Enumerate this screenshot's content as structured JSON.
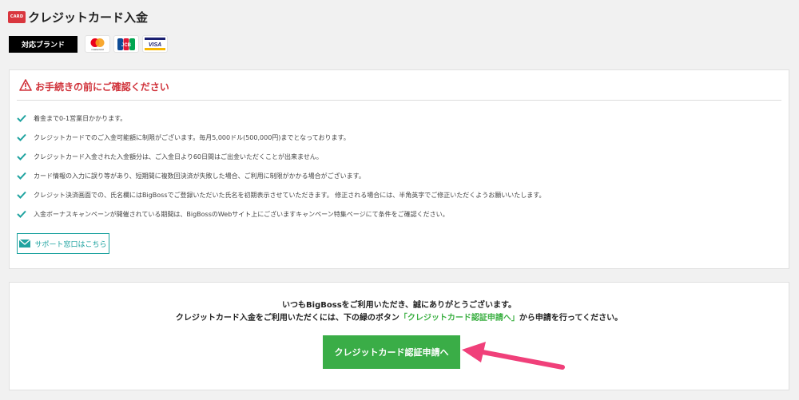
{
  "header": {
    "card_icon_text": "CARD",
    "title": "クレジットカード入金"
  },
  "brands": {
    "label": "対応ブランド",
    "logos": [
      {
        "name": "Mastercard",
        "text": "mastercard",
        "icon": "mastercard-logo"
      },
      {
        "name": "JCB",
        "text": "JCB",
        "icon": "jcb-logo"
      },
      {
        "name": "VISA",
        "text": "VISA",
        "icon": "visa-logo"
      }
    ]
  },
  "notice": {
    "icon": "warning-icon",
    "title": "お手続きの前にご確認ください",
    "items": [
      "着金まで0-1営業日かかります。",
      "クレジットカードでのご入金可能額に制限がございます。毎月5,000ドル(500,000円)までとなっております。",
      "クレジットカード入金された入金額分は、ご入金日より60日間はご出金いただくことが出来ません。",
      "カード情報の入力に誤り等があり、短期間に複数回決済が失敗した場合、ご利用に制限がかかる場合がございます。",
      "クレジット決済画面での、氏名欄にはBigBossでご登録いただいた氏名を初期表示させていただきます。 修正される場合には、半角英字でご修正いただくようお願いいたします。",
      "入金ボーナスキャンペーンが開催されている期間は、BigBossのWebサイト上にございますキャンペーン特集ページにて条件をご確認ください。"
    ],
    "support_label": "サポート窓口はこちら"
  },
  "panel": {
    "line1": "いつもBigBossをご利用いただき、誠にありがとうございます。",
    "line2_pre": "クレジットカード入金をご利用いただくには、下の緑のボタン",
    "line2_highlight": "「クレジットカード認証申請へ」",
    "line2_post": "から申請を行ってください。",
    "button_label": "クレジットカード認証申請へ"
  },
  "colors": {
    "accent_red": "#d0323a",
    "teal": "#1fa3a0",
    "green": "#3aad47",
    "arrow_pink": "#f0407a"
  }
}
